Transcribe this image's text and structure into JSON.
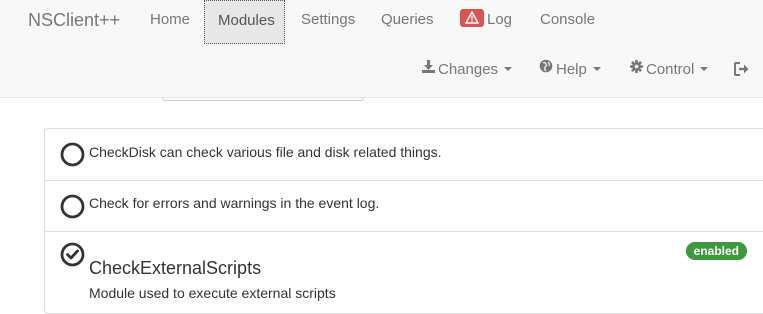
{
  "brand": "NSClient++",
  "nav": {
    "home": "Home",
    "modules": "Modules",
    "settings": "Settings",
    "queries": "Queries",
    "log": "Log",
    "console": "Console"
  },
  "right_nav": {
    "changes": "Changes",
    "help": "Help",
    "control": "Control"
  },
  "modules": [
    {
      "description": "CheckDisk can check various file and disk related things.",
      "enabled": false
    },
    {
      "description": "Check for errors and warnings in the event log.",
      "enabled": false
    },
    {
      "name": "CheckExternalScripts",
      "description": "Module used to execute external scripts",
      "enabled": true,
      "badge": "enabled"
    }
  ],
  "colors": {
    "navbar_bg": "#f8f8f8",
    "log_badge": "#d9534f",
    "enabled_badge": "#3c9a3c"
  },
  "icons": {
    "log": "warning-icon",
    "changes": "download-icon",
    "help": "globe-icon",
    "control": "cog-icon",
    "logout": "logout-icon"
  }
}
